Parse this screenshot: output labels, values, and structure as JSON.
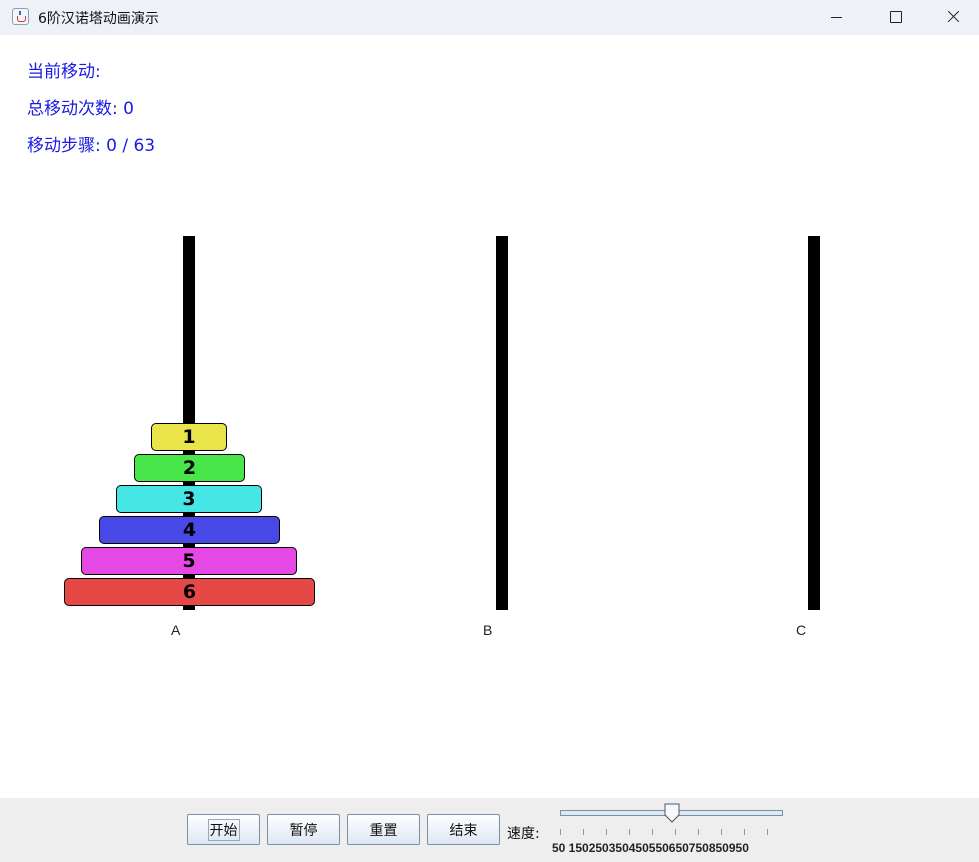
{
  "window": {
    "title": "6阶汉诺塔动画演示"
  },
  "info": {
    "current_move": "当前移动:",
    "total_moves": "总移动次数: 0",
    "steps": "移动步骤: 0 / 63"
  },
  "pegs": [
    {
      "label": "A"
    },
    {
      "label": "B"
    },
    {
      "label": "C"
    }
  ],
  "disks": [
    {
      "label": "1",
      "color": "#e8e44a"
    },
    {
      "label": "2",
      "color": "#48e64a"
    },
    {
      "label": "3",
      "color": "#46e6e6"
    },
    {
      "label": "4",
      "color": "#4848e6"
    },
    {
      "label": "5",
      "color": "#e648e6"
    },
    {
      "label": "6",
      "color": "#e64848"
    }
  ],
  "controls": {
    "start_label": "开始",
    "pause_label": "暂停",
    "reset_label": "重置",
    "end_label": "结束",
    "speed_label": "速度:",
    "speed_min": 50,
    "speed_max": 950,
    "speed_value": 500,
    "speed_tick_labels": "50 150250350450550650750850950"
  }
}
